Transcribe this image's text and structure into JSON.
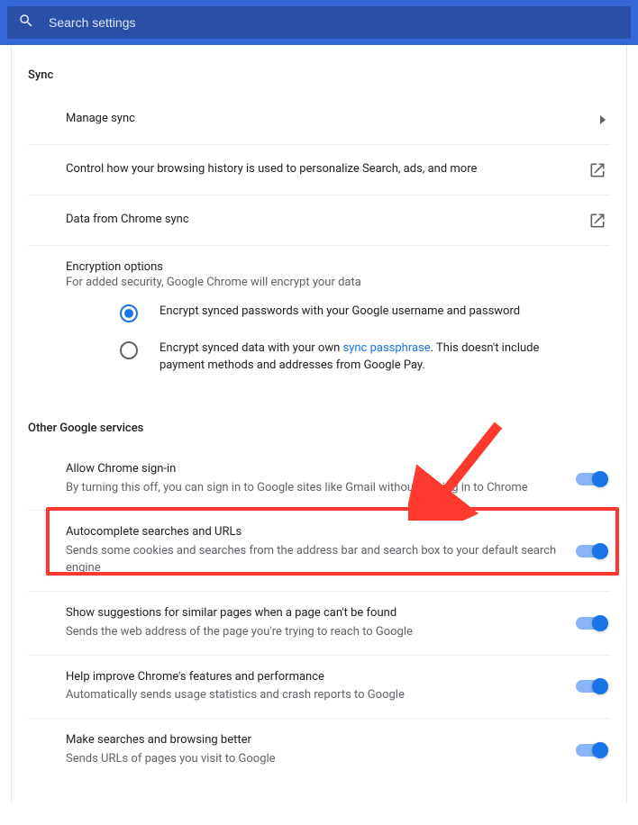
{
  "search": {
    "placeholder": "Search settings"
  },
  "sync": {
    "title": "Sync",
    "rows": [
      {
        "label": "Manage sync"
      },
      {
        "label": "Control how your browsing history is used to personalize Search, ads, and more"
      },
      {
        "label": "Data from Chrome sync"
      }
    ],
    "encryption": {
      "title": "Encryption options",
      "desc": "For added security, Google Chrome will encrypt your data",
      "opt1": "Encrypt synced passwords with your Google username and password",
      "opt2_a": "Encrypt synced data with your own ",
      "opt2_link": "sync passphrase",
      "opt2_b": ". This doesn't include payment methods and addresses from Google Pay."
    }
  },
  "services": {
    "title": "Other Google services",
    "items": [
      {
        "label": "Allow Chrome sign-in",
        "desc": "By turning this off, you can sign in to Google sites like Gmail without signing in to Chrome"
      },
      {
        "label": "Autocomplete searches and URLs",
        "desc": "Sends some cookies and searches from the address bar and search box to your default search engine"
      },
      {
        "label": "Show suggestions for similar pages when a page can't be found",
        "desc": "Sends the web address of the page you're trying to reach to Google"
      },
      {
        "label": "Help improve Chrome's features and performance",
        "desc": "Automatically sends usage statistics and crash reports to Google"
      },
      {
        "label": "Make searches and browsing better",
        "desc": "Sends URLs of pages you visit to Google"
      }
    ]
  }
}
